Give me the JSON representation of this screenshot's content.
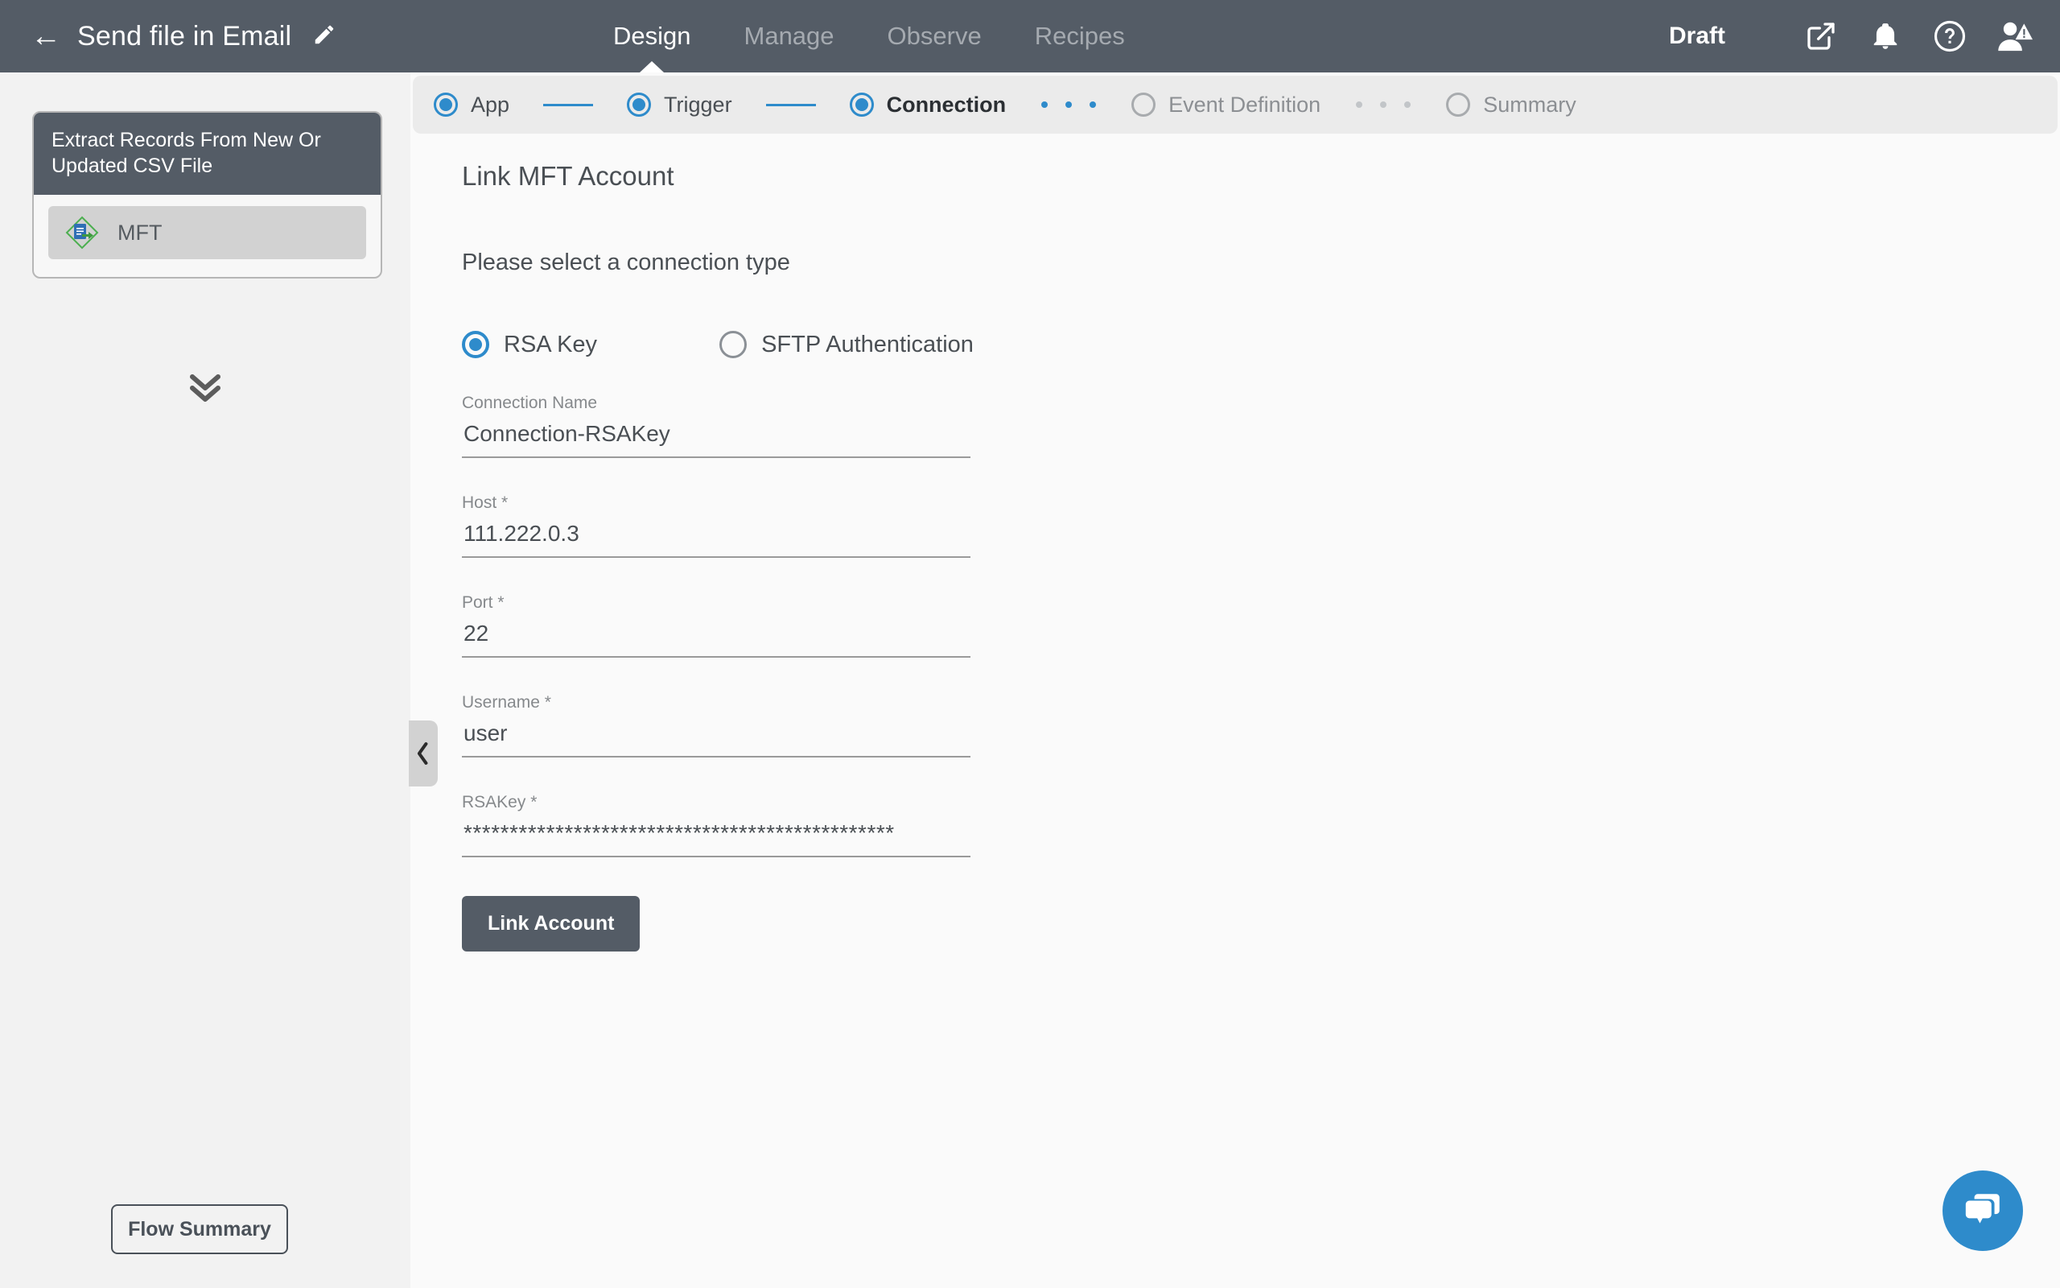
{
  "topbar": {
    "back_icon": "back-arrow-icon",
    "flow_title": "Send file in Email",
    "edit_icon": "pencil-icon",
    "nav": [
      {
        "label": "Design",
        "active": true
      },
      {
        "label": "Manage",
        "active": false
      },
      {
        "label": "Observe",
        "active": false
      },
      {
        "label": "Recipes",
        "active": false
      }
    ],
    "status": "Draft",
    "icons": [
      "external-link-icon",
      "bell-icon",
      "help-circle-icon",
      "user-avatar-warning-icon"
    ]
  },
  "stepper": {
    "steps": [
      {
        "label": "App",
        "state": "done"
      },
      {
        "label": "Trigger",
        "state": "done"
      },
      {
        "label": "Connection",
        "state": "current"
      },
      {
        "label": "Event Definition",
        "state": "pending"
      },
      {
        "label": "Summary",
        "state": "pending"
      }
    ]
  },
  "sidebar": {
    "node": {
      "title": "Extract Records From New Or Updated CSV File",
      "app_label": "MFT",
      "app_icon": "mft-app-icon"
    },
    "expand_icon": "chevron-double-down-icon",
    "flow_summary_label": "Flow Summary"
  },
  "main": {
    "collapse_icon": "chevron-left-icon",
    "title": "Link MFT Account",
    "subtitle": "Please select a connection type",
    "connection_types": [
      {
        "label": "RSA Key",
        "selected": true
      },
      {
        "label": "SFTP Authentication",
        "selected": false
      }
    ],
    "fields": [
      {
        "label": "Connection Name",
        "value": "Connection-RSAKey",
        "placeholder": "Connection Name"
      },
      {
        "label": "Host *",
        "value": "111.222.0.3",
        "placeholder": "Host"
      },
      {
        "label": "Port *",
        "value": "22",
        "placeholder": "Port"
      },
      {
        "label": "Username *",
        "value": "user",
        "placeholder": "Username"
      },
      {
        "label": "RSAKey *",
        "value": "***********************************************",
        "placeholder": "RSAKey"
      }
    ],
    "submit_label": "Link Account"
  },
  "chat": {
    "icon": "chat-bubbles-icon"
  },
  "colors": {
    "header": "#545c66",
    "accent_blue": "#2e8bcb",
    "panel_grey": "#ebebeb",
    "sidebar_grey": "#f2f2f2",
    "main_bg": "#fafafa"
  }
}
